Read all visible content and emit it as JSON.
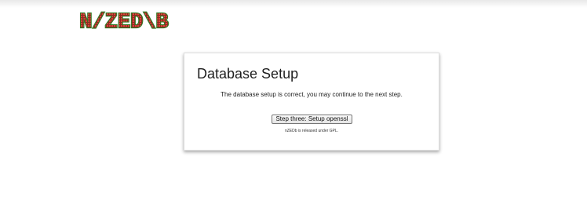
{
  "logo": {
    "text": "N/ZED\\B",
    "colors": {
      "fill": "#d9453a",
      "outline": "#2f7a24"
    }
  },
  "setup_panel": {
    "title": "Database Setup",
    "message": "The database setup is correct, you may continue to the next step.",
    "next_button": "Step three: Setup openssl",
    "license_note": "nZEDb is released under GPL."
  }
}
